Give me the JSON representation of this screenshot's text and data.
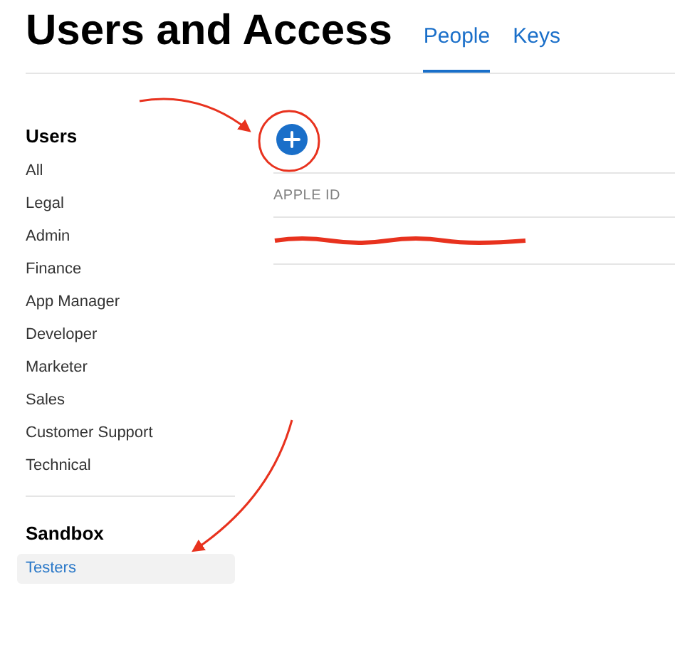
{
  "title": "Users and Access",
  "tabs": [
    {
      "label": "People",
      "selected": true
    },
    {
      "label": "Keys",
      "selected": false
    }
  ],
  "sidebar": {
    "sections": [
      {
        "heading": "Users",
        "items": [
          {
            "label": "All",
            "selected": false
          },
          {
            "label": "Legal",
            "selected": false
          },
          {
            "label": "Admin",
            "selected": false
          },
          {
            "label": "Finance",
            "selected": false
          },
          {
            "label": "App Manager",
            "selected": false
          },
          {
            "label": "Developer",
            "selected": false
          },
          {
            "label": "Marketer",
            "selected": false
          },
          {
            "label": "Sales",
            "selected": false
          },
          {
            "label": "Customer Support",
            "selected": false
          },
          {
            "label": "Technical",
            "selected": false
          }
        ]
      },
      {
        "heading": "Sandbox",
        "items": [
          {
            "label": "Testers",
            "selected": true
          }
        ]
      }
    ]
  },
  "table": {
    "columns": [
      "APPLE ID"
    ],
    "rows": [
      {
        "redacted": true
      }
    ]
  }
}
